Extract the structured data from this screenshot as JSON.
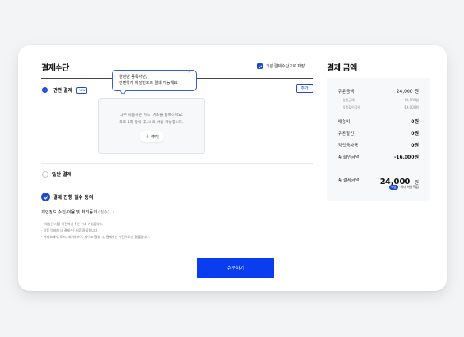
{
  "left": {
    "title": "결제수단",
    "default_method_label": "기본 결제수단으로 저장",
    "simple_pay": {
      "label": "간편 결제",
      "badge": "new",
      "add_button": "추가"
    },
    "tooltip": {
      "line1": "한번만 등록하면,",
      "line2": "간편하게 비밀번호로 결제 가능해요!",
      "close": "×"
    },
    "empty": {
      "line1": "자주 사용하는 카드, 계좌를 등록하세요.",
      "line2": "최초 1회 등록 후, 바로 사용 가능합니다.",
      "add_chip": "추가"
    },
    "general_pay": {
      "label": "일반 결제"
    },
    "agree": {
      "label": "결제 진행 필수 동의"
    },
    "privacy": {
      "label": "개인정보 수집·이용 및 처리동의",
      "required": "(필수)"
    },
    "notes": [
      "- [배송준비중] 이전까지 주문 취소 가능합니다.",
      "- 상품 미배송 시 결제수단으로 환불됩니다.",
      "- 카카오페이, 토스, 네이버페이, 페이코 결제 시, 결제하신 수단으로만 환불됩니다."
    ],
    "order_button": "주문하기"
  },
  "right": {
    "title": "결제 금액",
    "order_amount": {
      "label": "주문금액",
      "value": "24,000 원"
    },
    "product_amount": {
      "label": "상품금액",
      "value": "40,000원"
    },
    "product_discount": {
      "label": "상품할인금액",
      "value": "-16,000원"
    },
    "shipping": {
      "label": "배송비",
      "value": "0원"
    },
    "coupon": {
      "label": "쿠폰할인",
      "value": "0원"
    },
    "points_used": {
      "label": "적립금사용",
      "value": "0원"
    },
    "total_discount": {
      "label": "총 할인금액",
      "value": "-16,000원"
    },
    "total": {
      "label": "총 결제금액",
      "amount": "24,000",
      "unit": "원"
    },
    "reward": {
      "chip": "적립",
      "text": "최대 0원 적립"
    }
  },
  "colors": {
    "accent": "#1f4ad1",
    "order_button": "#0a3cf0"
  }
}
